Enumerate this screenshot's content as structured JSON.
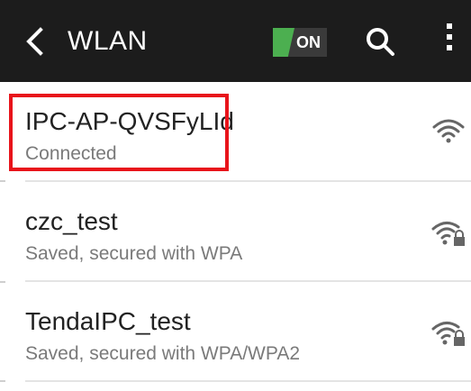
{
  "header": {
    "title": "WLAN",
    "toggle_label": "ON",
    "back_icon": "chevron-left-icon",
    "search_icon": "search-icon",
    "more_icon": "more-vertical-icon"
  },
  "colors": {
    "header_bg": "#1c1c1c",
    "toggle_on": "#4caf50",
    "highlight": "#e8141b",
    "primary_text": "#222222",
    "secondary_text": "#7a7a7a"
  },
  "networks": [
    {
      "name": "IPC-AP-QVSFyLId",
      "status": "Connected",
      "secured": false,
      "icon": "wifi-signal-icon"
    },
    {
      "name": "czc_test",
      "status": "Saved, secured with WPA",
      "secured": true,
      "icon": "wifi-lock-icon"
    },
    {
      "name": "TendaIPC_test",
      "status": "Saved, secured with WPA/WPA2",
      "secured": true,
      "icon": "wifi-lock-icon"
    }
  ]
}
